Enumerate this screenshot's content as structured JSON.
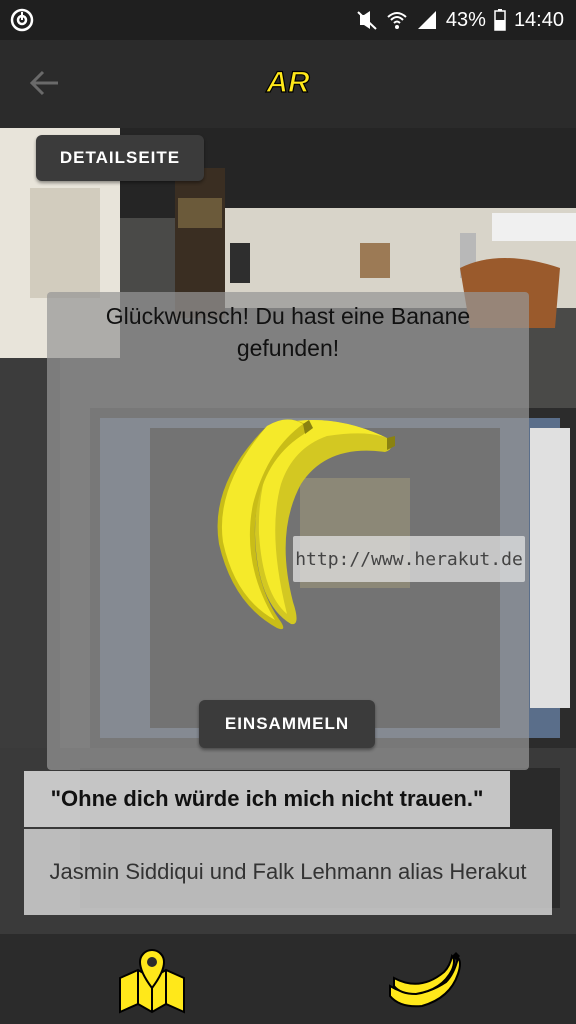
{
  "status_bar": {
    "battery_percent": "43%",
    "time": "14:40",
    "icons": [
      "app-notification-icon",
      "mute-icon",
      "wifi-icon",
      "signal-icon",
      "battery-icon"
    ]
  },
  "app_bar": {
    "back_icon": "arrow-left-icon",
    "logo_text": "AR"
  },
  "camera_view": {
    "detail_button": "DETAILSEITE"
  },
  "dialog": {
    "message": "Glückwunsch! Du hast eine Banane gefunden!",
    "url": "http://www.herakut.de",
    "collect_button": "EINSAMMELN"
  },
  "quote": {
    "text": "\"Ohne dich würde ich mich nicht trauen.\"",
    "author": "Jasmin Siddiqui und Falk Lehmann alias Herakut"
  },
  "bottom_nav": {
    "items": [
      {
        "icon": "map-pin-icon",
        "active": false
      },
      {
        "icon": "banana-icon",
        "active": true
      }
    ]
  },
  "colors": {
    "accent_yellow": "#FFE81A",
    "bar_dark": "#2B2B2B",
    "status_bar": "#1F1F1F",
    "button_dark": "#3B3B3B"
  }
}
